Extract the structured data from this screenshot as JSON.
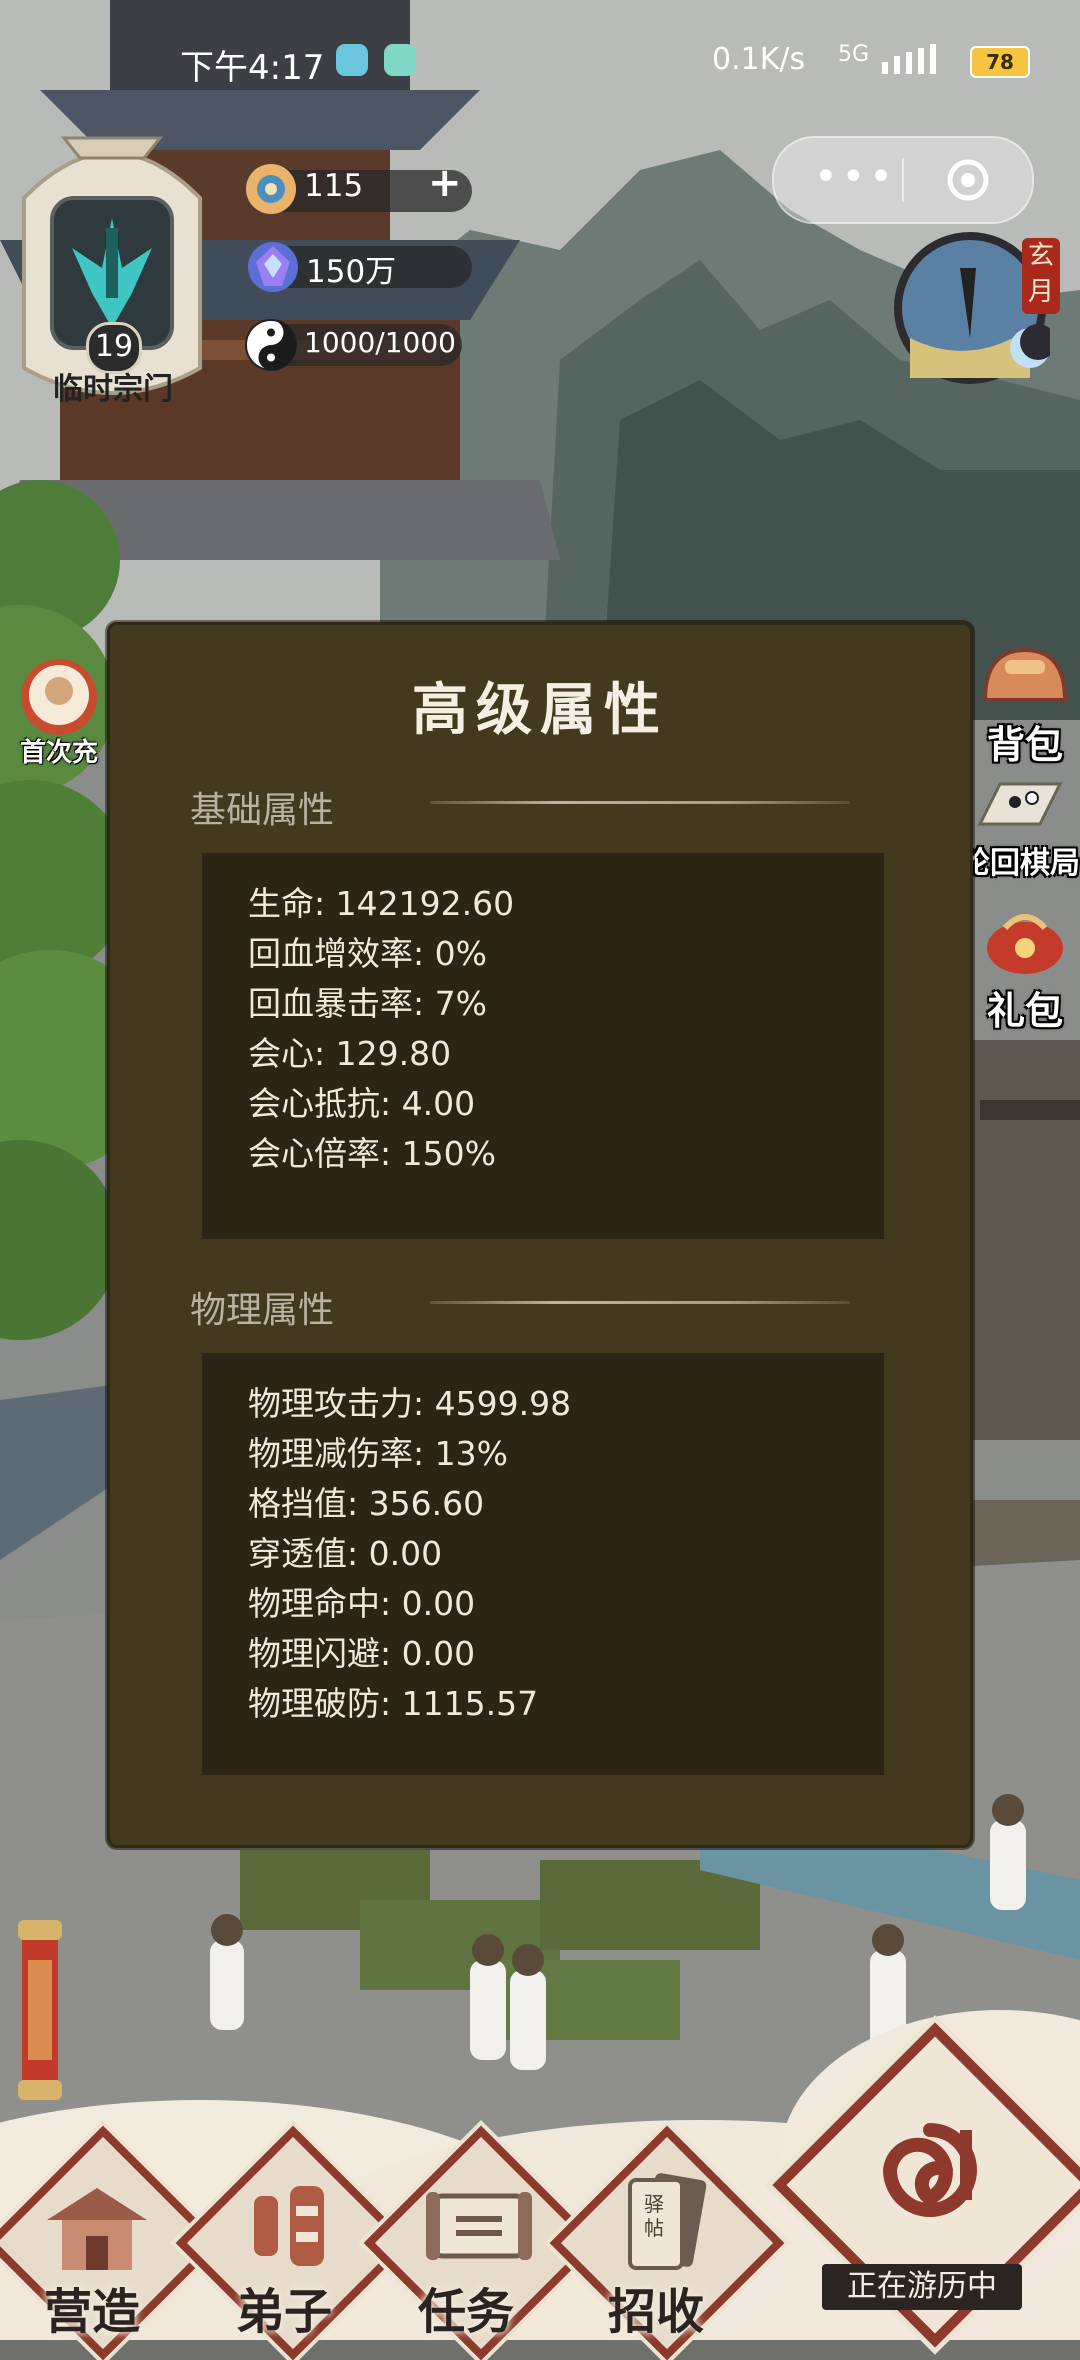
{
  "status_bar": {
    "time": "下午4:17",
    "net_speed": "0.1K/s",
    "network": "5G",
    "battery": "78"
  },
  "sect": {
    "level": "19",
    "name": "临时宗门"
  },
  "resources": {
    "stamina": "115",
    "spirit_stones": "150万",
    "taiji": "1000/1000"
  },
  "month_badge": "玄月",
  "side_menu": {
    "first_charge": "首次充",
    "bag": "背包",
    "chess": "轮回棋局",
    "gift": "礼包"
  },
  "panel": {
    "title": "高级属性",
    "basic": {
      "title": "基础属性",
      "stats": [
        "生命: 142192.60",
        "回血增效率: 0%",
        "回血暴击率: 7%",
        "会心: 129.80",
        "会心抵抗: 4.00",
        "会心倍率: 150%"
      ]
    },
    "physical": {
      "title": "物理属性",
      "stats": [
        "物理攻击力: 4599.98",
        "物理减伤率: 13%",
        "格挡值: 356.60",
        "穿透值: 0.00",
        "物理命中: 0.00",
        "物理闪避: 0.00",
        "物理破防: 1115.57"
      ]
    }
  },
  "bottom_nav": {
    "build": "营造",
    "disciples": "弟子",
    "tasks": "任务",
    "recruit": "招收",
    "recruit_card": "驿帖",
    "traveling": "正在游历中"
  },
  "colors": {
    "panel_bg": "#43391f",
    "stat_box_bg": "#2c2516",
    "accent_red": "#8d3a2c",
    "sect_teal": "#3fc6c4"
  }
}
